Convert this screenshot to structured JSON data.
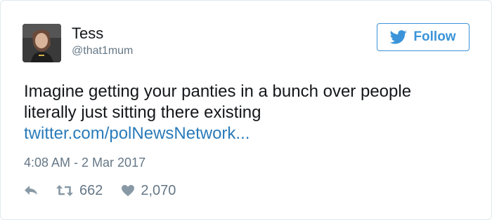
{
  "author": {
    "display_name": "Tess",
    "handle": "@that1mum"
  },
  "follow_button": {
    "label": "Follow"
  },
  "tweet": {
    "text_line_1": "Imagine getting your panties in a bunch over people",
    "text_line_2": "literally just sitting there existing",
    "link_text": "twitter.com/polNewsNetwork...",
    "timestamp": "4:08 AM - 2 Mar 2017"
  },
  "stats": {
    "retweets": "662",
    "likes": "2,070"
  },
  "colors": {
    "twitter_blue": "#3b94d9",
    "link_blue": "#2b7bb9",
    "text": "#14171a",
    "muted": "#657786",
    "icon_gray": "#8899a6"
  },
  "icons": {
    "follow": "twitter-bird-icon",
    "reply": "reply-icon",
    "retweet": "retweet-icon",
    "like": "heart-icon"
  }
}
